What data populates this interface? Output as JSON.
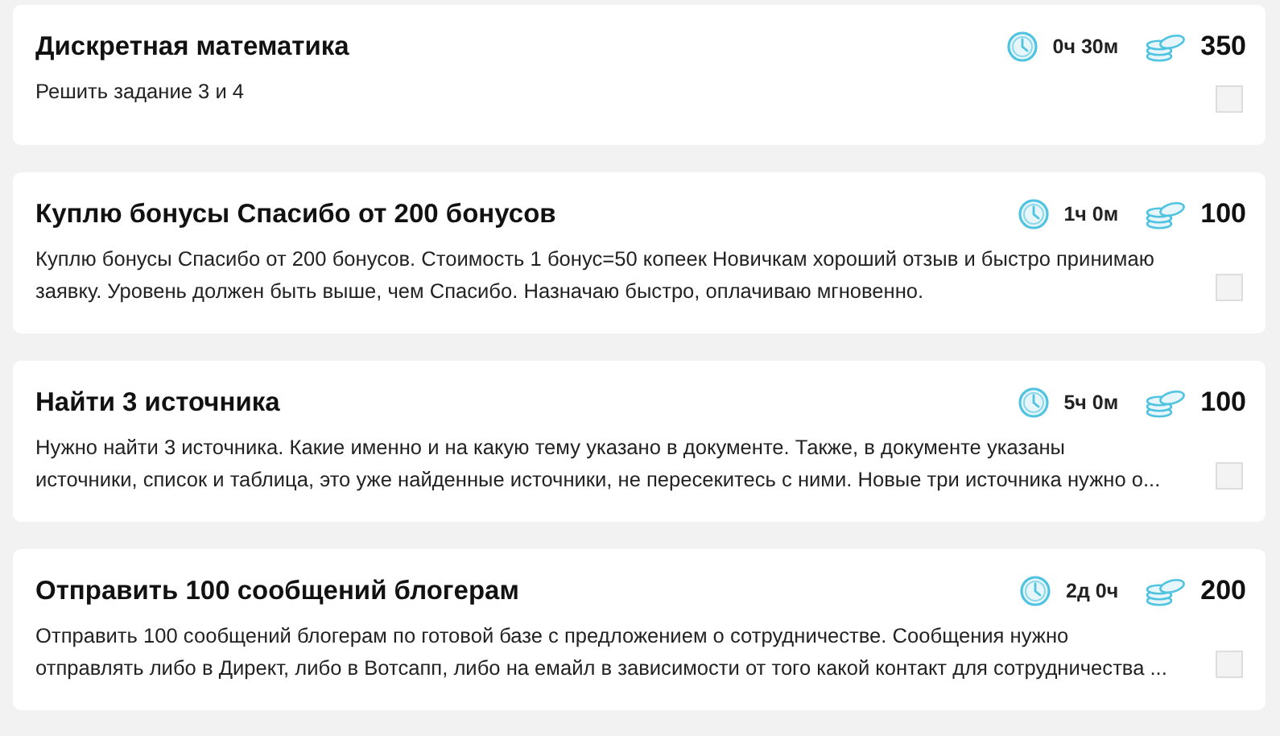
{
  "tasks": [
    {
      "title": "Дискретная математика",
      "time": "0ч 30м",
      "price": "350",
      "description": "Решить задание 3 и 4",
      "checked": false
    },
    {
      "title": "Куплю бонусы Спасибо от 200 бонусов",
      "time": "1ч 0м",
      "price": "100",
      "description": "Куплю бонусы Спасибо от 200 бонусов. Стоимость 1 бонус=50 копеек Новичкам хороший отзыв и быстро принимаю\nзаявку. Уровень должен быть выше, чем Спасибо. Назначаю быстро, оплачиваю мгновенно.",
      "checked": false
    },
    {
      "title": "Найти 3 источника",
      "time": "5ч 0м",
      "price": "100",
      "description": "Нужно найти 3 источника. Какие именно и на какую тему указано в документе. Также, в документе указаны\nисточники, список и таблица, это уже найденные источники, не пересекитесь с ними. Новые три источника нужно о...",
      "checked": false
    },
    {
      "title": "Отправить 100 сообщений блогерам",
      "time": "2д 0ч",
      "price": "200",
      "description": "Отправить 100 сообщений блогерам по готовой базе с предложением о сотрудничестве. Сообщения нужно\nотправлять либо в Директ, либо в Вотсапп, либо на емайл в зависимости от того какой контакт для сотрудничества ...",
      "checked": false
    }
  ]
}
